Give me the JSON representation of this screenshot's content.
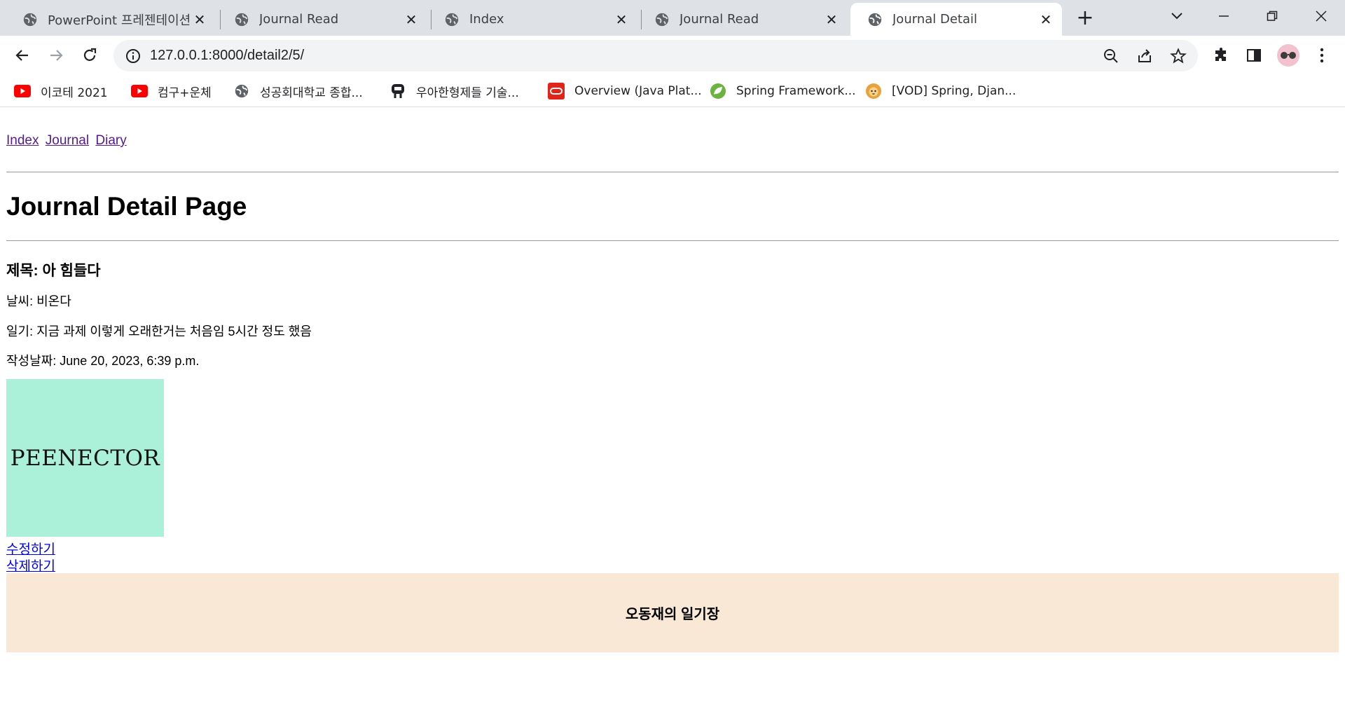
{
  "browser": {
    "tabs": [
      {
        "title": "PowerPoint 프레젠테이션",
        "active": false
      },
      {
        "title": "Journal Read",
        "active": false
      },
      {
        "title": "Index",
        "active": false
      },
      {
        "title": "Journal Read",
        "active": false
      },
      {
        "title": "Journal Detail",
        "active": true
      }
    ],
    "url": "127.0.0.1:8000/detail2/5/",
    "bookmarks": [
      {
        "label": "이코테 2021",
        "icon": "youtube-icon"
      },
      {
        "label": "컴구+운체",
        "icon": "youtube-icon"
      },
      {
        "label": "성공회대학교 종합...",
        "icon": "globe-icon"
      },
      {
        "label": "우아한형제들 기술...",
        "icon": "woowahan-icon"
      },
      {
        "label": "Overview (Java Plat...",
        "icon": "oracle-icon"
      },
      {
        "label": "Spring Framework...",
        "icon": "spring-icon"
      },
      {
        "label": "[VOD] Spring, Djan...",
        "icon": "lion-icon"
      }
    ]
  },
  "page": {
    "nav": {
      "index": "Index",
      "journal": "Journal",
      "diary": "Diary"
    },
    "heading": "Journal Detail Page",
    "title_line": "제목: 아 힘들다",
    "weather_line": "날씨: 비온다",
    "diary_line": "일기: 지금 과제 이렇게 오래한거는 처음임 5시간 정도 했음",
    "date_line": "작성날짜: June 20, 2023, 6:39 p.m.",
    "image_text": "PEENECTOR",
    "edit_link": "수정하기",
    "delete_link": "삭제하기",
    "footer": "오동재의 일기장"
  },
  "colors": {
    "image_bg": "#abf0d9",
    "footer_bg": "#fae8d6",
    "visited_link": "#551a8b",
    "link": "#0000ee"
  }
}
